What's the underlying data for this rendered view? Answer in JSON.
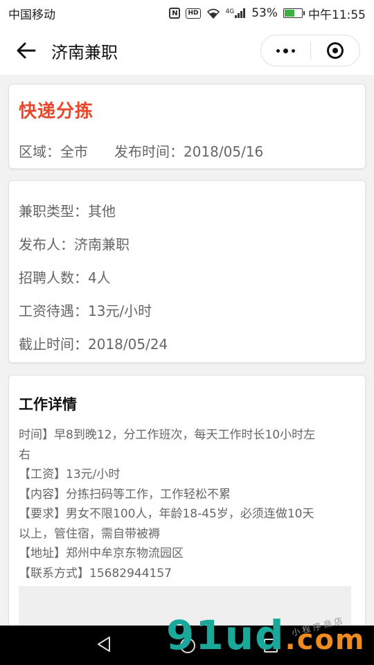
{
  "status_bar": {
    "carrier": "中国移动",
    "network": "4G",
    "battery": "53%",
    "battery_level": 0.53,
    "time": "中午11:55"
  },
  "nav": {
    "title": "济南兼职"
  },
  "job": {
    "title": "快递分拣",
    "region": "区域：全市",
    "publish_time": "发布时间：2018/05/16"
  },
  "info": {
    "type": "兼职类型：其他",
    "publisher": "发布人：济南兼职",
    "headcount": "招聘人数：4人",
    "salary": "工资待遇：13元/小时",
    "deadline": "截止时间：2018/05/24"
  },
  "details": {
    "title": "工作详情",
    "lines": [
      "时间】早8到晚12，分工作班次，每天工作时长10小时左",
      "右",
      "【工资】13元/小时",
      "【内容】分拣扫码等工作，工作轻松不累",
      "【要求】男女不限100人，年龄18-45岁，必须连做10天",
      "以上，管住宿，需自带被褥",
      "【地址】郑州中牟京东物流园区",
      "【联系方式】15682944157"
    ]
  },
  "watermark": {
    "main": "91ud",
    "suffix": ".com",
    "small": "小 程 序 商 店"
  },
  "colors": {
    "accent": "#e8472b",
    "watermark_teal": "#19a89a",
    "watermark_orange": "#f08c1e"
  }
}
